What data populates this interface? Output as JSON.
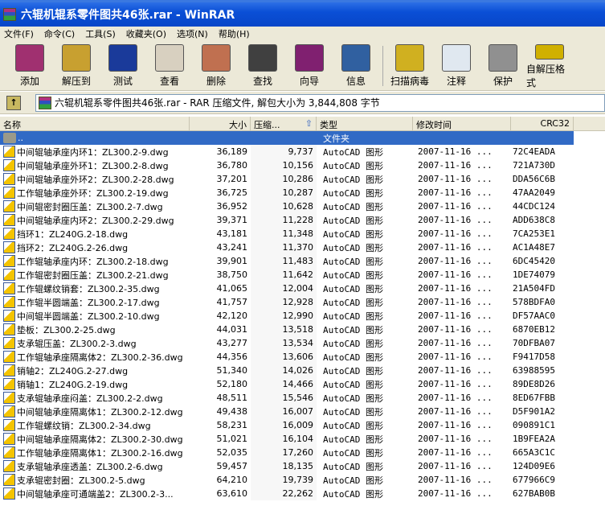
{
  "window": {
    "title": "六辊机辊系零件图共46张.rar - WinRAR"
  },
  "menu": [
    "文件(F)",
    "命令(C)",
    "工具(S)",
    "收藏夹(O)",
    "选项(N)",
    "帮助(H)"
  ],
  "toolbar": [
    {
      "label": "添加",
      "icon": "add-archive-icon",
      "color": "#a03070"
    },
    {
      "label": "解压到",
      "icon": "extract-to-icon",
      "color": "#c8a030"
    },
    {
      "label": "测试",
      "icon": "test-icon",
      "color": "#1a3a9a"
    },
    {
      "label": "查看",
      "icon": "view-icon",
      "color": "#d8d0c0"
    },
    {
      "label": "删除",
      "icon": "delete-icon",
      "color": "#c07050"
    },
    {
      "label": "查找",
      "icon": "find-icon",
      "color": "#404040"
    },
    {
      "label": "向导",
      "icon": "wizard-icon",
      "color": "#802070"
    },
    {
      "label": "信息",
      "icon": "info-icon",
      "color": "#3060a0"
    },
    {
      "label": "扫描病毒",
      "icon": "virus-scan-icon",
      "color": "#d0b020"
    },
    {
      "label": "注释",
      "icon": "comment-icon",
      "color": "#e0e8f0"
    },
    {
      "label": "保护",
      "icon": "protect-icon",
      "color": "#909090"
    },
    {
      "label": "自解压格式",
      "icon": "sfx-icon",
      "color": "#d0b000"
    }
  ],
  "address": {
    "text": "六辊机辊系零件图共46张.rar - RAR 压缩文件, 解包大小为 3,844,808 字节"
  },
  "columns": {
    "name": "名称",
    "size": "大小",
    "packed": "压缩...",
    "type": "类型",
    "modified": "修改时间",
    "crc": "CRC32",
    "sort": "packed-ascending"
  },
  "parent_row": {
    "name": "..",
    "type": "文件夹"
  },
  "files": [
    [
      "中间辊轴承座内环1：ZL300.2-9.dwg",
      "36,189",
      "9,737",
      "72C4EADA"
    ],
    [
      "中间辊轴承座外环1：ZL300.2-8.dwg",
      "36,780",
      "10,156",
      "721A730D"
    ],
    [
      "中间辊轴承座外环2：ZL300.2-28.dwg",
      "37,201",
      "10,286",
      "DDA56C6B"
    ],
    [
      "工作辊轴承座外环：ZL300.2-19.dwg",
      "36,725",
      "10,287",
      "47AA2049"
    ],
    [
      "中间辊密封圈压盖：ZL300.2-7.dwg",
      "36,952",
      "10,628",
      "44CDC124"
    ],
    [
      "中间辊轴承座内环2：ZL300.2-29.dwg",
      "39,371",
      "11,228",
      "ADD638C8"
    ],
    [
      "挡环1：ZL240G.2-18.dwg",
      "43,181",
      "11,348",
      "7CA253E1"
    ],
    [
      "挡环2：ZL240G.2-26.dwg",
      "43,241",
      "11,370",
      "AC1A48E7"
    ],
    [
      "工作辊轴承座内环：ZL300.2-18.dwg",
      "39,901",
      "11,483",
      "6DC45420"
    ],
    [
      "工作辊密封圈压盖：ZL300.2-21.dwg",
      "38,750",
      "11,642",
      "1DE74079"
    ],
    [
      "工作辊螺纹销套：ZL300.2-35.dwg",
      "41,065",
      "12,004",
      "21A504FD"
    ],
    [
      "工作辊半圆端盖：ZL300.2-17.dwg",
      "41,757",
      "12,928",
      "578BDFA0"
    ],
    [
      "中间辊半圆端盖：ZL300.2-10.dwg",
      "42,120",
      "12,990",
      "DF57AAC0"
    ],
    [
      "垫板：ZL300.2-25.dwg",
      "44,031",
      "13,518",
      "6870EB12"
    ],
    [
      "支承辊压盖：ZL300.2-3.dwg",
      "43,277",
      "13,534",
      "70DFBA07"
    ],
    [
      "工作辊轴承座隔离体2：ZL300.2-36.dwg",
      "44,356",
      "13,606",
      "F9417D58"
    ],
    [
      "销轴2：ZL240G.2-27.dwg",
      "51,340",
      "14,026",
      "63988595"
    ],
    [
      "销轴1：ZL240G.2-19.dwg",
      "52,180",
      "14,466",
      "89DE8D26"
    ],
    [
      "支承辊轴承座闷盖：ZL300.2-2.dwg",
      "48,511",
      "15,546",
      "8ED67FBB"
    ],
    [
      "中间辊轴承座隔离体1：ZL300.2-12.dwg",
      "49,438",
      "16,007",
      "D5F901A2"
    ],
    [
      "工作辊螺纹销：ZL300.2-34.dwg",
      "58,231",
      "16,009",
      "090891C1"
    ],
    [
      "中间辊轴承座隔离体2：ZL300.2-30.dwg",
      "51,021",
      "16,104",
      "1B9FEA2A"
    ],
    [
      "工作辊轴承座隔离体1：ZL300.2-16.dwg",
      "52,035",
      "17,260",
      "665A3C1C"
    ],
    [
      "支承辊轴承座透盖：ZL300.2-6.dwg",
      "59,457",
      "18,135",
      "124D09E6"
    ],
    [
      "支承辊密封圈：ZL300.2-5.dwg",
      "64,210",
      "19,739",
      "677966C9"
    ],
    [
      "中间辊轴承座可通端盖2：ZL300.2-3...",
      "63,610",
      "22,262",
      "627BAB0B"
    ]
  ],
  "file_type": "AutoCAD 图形",
  "file_modified": "2007-11-16 ..."
}
